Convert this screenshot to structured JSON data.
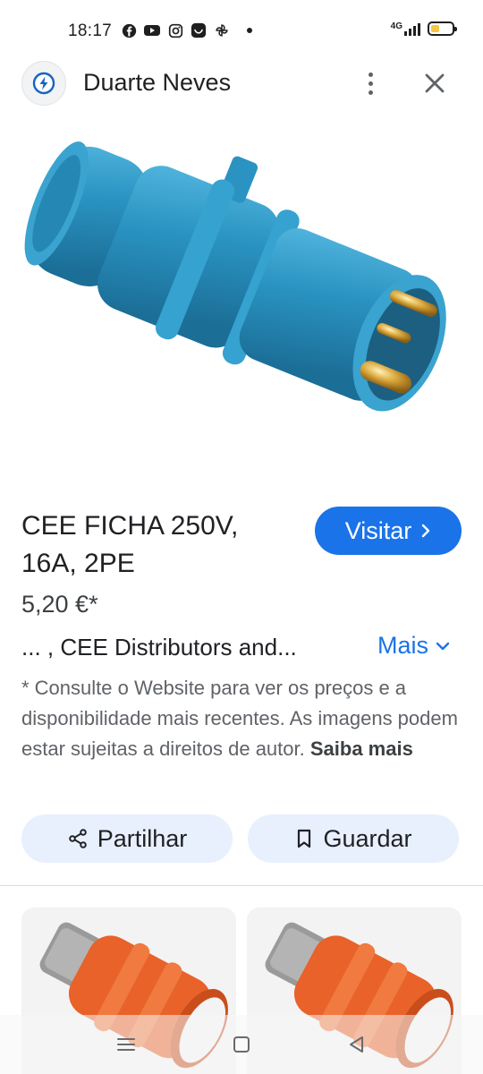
{
  "status_bar": {
    "time": "18:17",
    "network": "4G",
    "app_icons": [
      "facebook-icon",
      "youtube-icon",
      "instagram-icon",
      "messenger-icon",
      "pinwheel-icon"
    ]
  },
  "header": {
    "site_name": "Duarte Neves"
  },
  "product": {
    "title": "CEE FICHA 250V, 16A, 2PE",
    "visit_label": "Visitar",
    "price": "5,20 €*",
    "source_text": "... , CEE Distributors and...",
    "more_label": "Mais",
    "disclaimer": "* Consulte o Website para ver os preços e a disponibilidade mais recentes. As imagens podem estar sujeitas a direitos de autor.",
    "learn_more": "Saiba mais"
  },
  "actions": {
    "share_label": "Partilhar",
    "save_label": "Guardar"
  },
  "colors": {
    "accent": "#1a73e8",
    "button_tint": "#e8f0fe",
    "plug_blue": "#2a93c2",
    "plug_orange": "#e8622a"
  }
}
